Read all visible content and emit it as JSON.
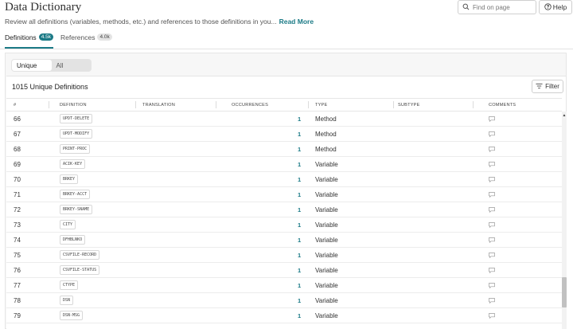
{
  "header": {
    "title": "Data Dictionary",
    "description": "Review all definitions (variables, methods, etc.) and references to those definitions in you...",
    "read_more": "Read More",
    "search_placeholder": "Find on page",
    "help_label": "Help"
  },
  "tabs": [
    {
      "label": "Definitions",
      "badge": "4.5k",
      "active": true
    },
    {
      "label": "References",
      "badge": "4.0k",
      "active": false
    }
  ],
  "toggle": {
    "options": [
      "Unique",
      "All"
    ],
    "selected": "Unique"
  },
  "table": {
    "title": "1015 Unique Definitions",
    "filter_label": "Filter",
    "columns": [
      "#",
      "DEFINITION",
      "TRANSLATION",
      "OCCURRENCES",
      "TYPE",
      "SUBTYPE",
      "COMMENTS"
    ],
    "rows": [
      {
        "num": "66",
        "definition": "UPDT-DELETE",
        "occurrences": "1",
        "type": "Method"
      },
      {
        "num": "67",
        "definition": "UPDT-MODIFY",
        "occurrences": "1",
        "type": "Method"
      },
      {
        "num": "68",
        "definition": "PRINT-PROC",
        "occurrences": "1",
        "type": "Method"
      },
      {
        "num": "69",
        "definition": "ACIK-KEY",
        "occurrences": "1",
        "type": "Variable"
      },
      {
        "num": "70",
        "definition": "BRKEY",
        "occurrences": "1",
        "type": "Variable"
      },
      {
        "num": "71",
        "definition": "BRKEY-ACCT",
        "occurrences": "1",
        "type": "Variable"
      },
      {
        "num": "72",
        "definition": "BRKEY-SNAME",
        "occurrences": "1",
        "type": "Variable"
      },
      {
        "num": "73",
        "definition": "CITY",
        "occurrences": "1",
        "type": "Variable"
      },
      {
        "num": "74",
        "definition": "DFHBLNKO",
        "occurrences": "1",
        "type": "Variable"
      },
      {
        "num": "75",
        "definition": "CSVFILE-RECORD",
        "occurrences": "1",
        "type": "Variable"
      },
      {
        "num": "76",
        "definition": "CSVFILE-STATUS",
        "occurrences": "1",
        "type": "Variable"
      },
      {
        "num": "77",
        "definition": "CTYPE",
        "occurrences": "1",
        "type": "Variable"
      },
      {
        "num": "78",
        "definition": "DSN",
        "occurrences": "1",
        "type": "Variable"
      },
      {
        "num": "79",
        "definition": "DSN-MSG",
        "occurrences": "1",
        "type": "Variable"
      }
    ]
  },
  "icons": {
    "search": "search-icon",
    "help": "help-circle-icon",
    "filter": "filter-icon",
    "comment": "comment-icon"
  },
  "colors": {
    "accent": "#1b7a86"
  }
}
